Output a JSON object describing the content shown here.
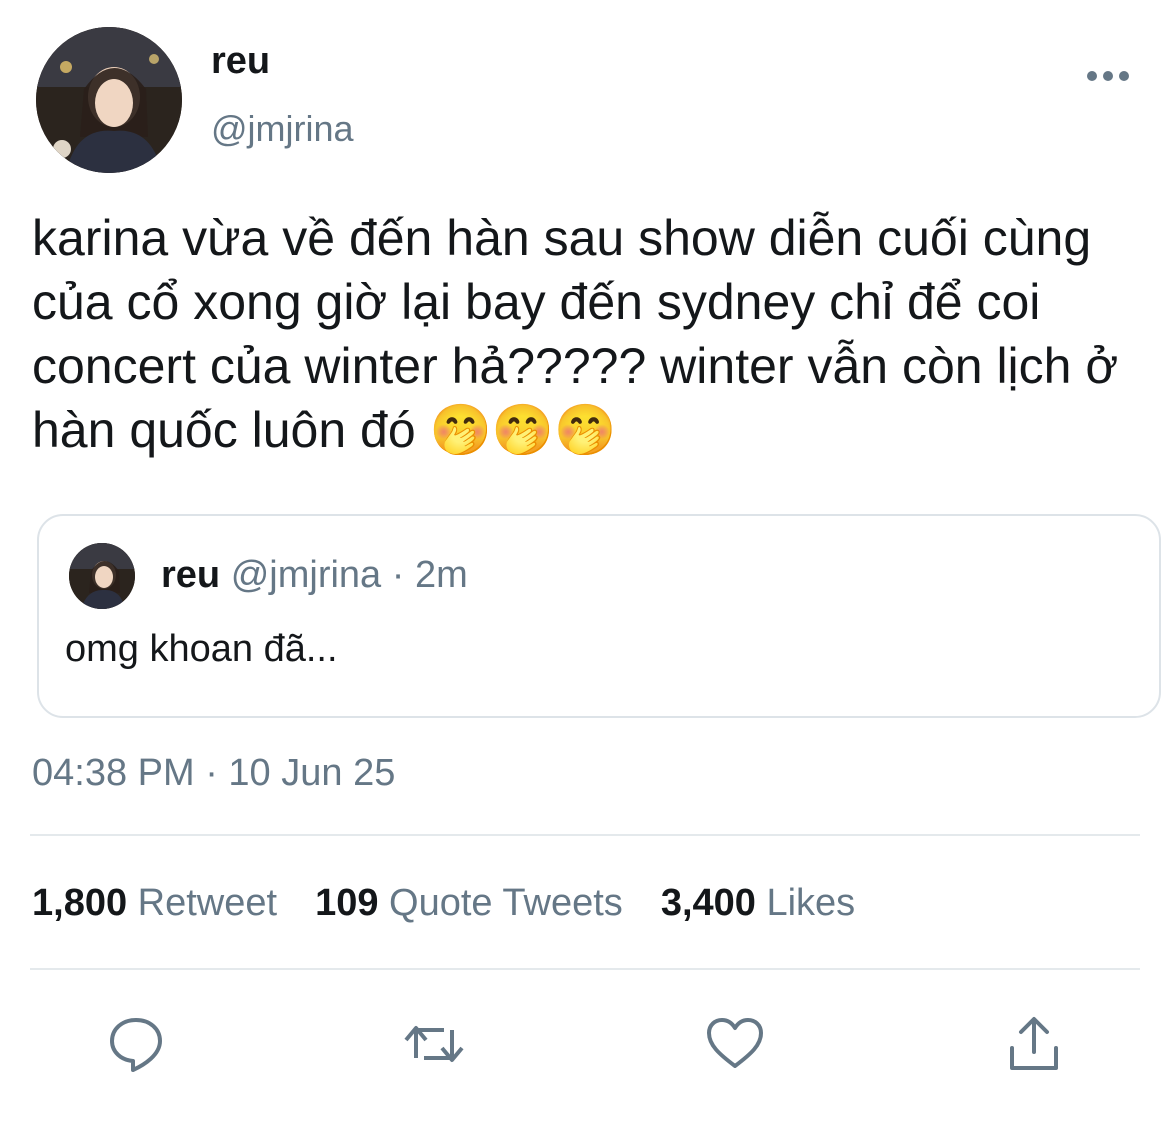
{
  "author": {
    "display_name": "reu",
    "handle": "@jmjrina"
  },
  "more_icon": "more-horizontal-icon",
  "tweet": {
    "text": "karina vừa về đến hàn sau show diễn cuối cùng của cổ xong giờ lại bay đến sydney chỉ để coi concert của winter hả????? winter vẫn còn lịch ở hàn quốc luôn đó 🤭🤭🤭"
  },
  "quote": {
    "display_name": "reu",
    "handle": "@jmjrina",
    "separator": "·",
    "time": "2m",
    "text": "omg khoan đã..."
  },
  "timestamp": "04:38 PM · 10 Jun 25",
  "stats": [
    {
      "count": "1,800",
      "label": "Retweet"
    },
    {
      "count": "109",
      "label": "Quote Tweets"
    },
    {
      "count": "3,400",
      "label": "Likes"
    }
  ],
  "actions": [
    "reply-icon",
    "retweet-icon",
    "like-icon",
    "share-icon"
  ],
  "colors": {
    "text": "#14171a",
    "secondary": "#657786",
    "border": "#dde3e8",
    "icon": "#657786"
  }
}
